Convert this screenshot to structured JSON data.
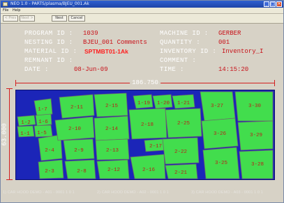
{
  "window": {
    "title": "NEO 1.0 - PARTS/plasma/BJEU_001.Ak",
    "min": "_",
    "max": "□",
    "close": "×"
  },
  "menu": {
    "file": "File",
    "help": "Help"
  },
  "toolbar": {
    "btn1": "< Prev",
    "btn2": "Next >",
    "btn3": "Nest",
    "btn4": "Cancel"
  },
  "info": {
    "program_id_label": "PROGRAM ID :",
    "program_id": "1039",
    "nesting_id_label": "NESTING ID :",
    "nesting_id": "BJEU_001 Comments",
    "material_id_label": "MATERIAL ID :",
    "material_id": "SPTMBT01-1Ak",
    "remnant_id_label": "REMNANT ID :",
    "remnant_id": "",
    "date_label": "DATE :",
    "date": "08-Jun-09",
    "machine_id_label": "MACHINE ID :",
    "machine_id": "GERBER",
    "quantity_label": "QUANTITY :",
    "quantity": "001",
    "inventory_id_label": "INVENTORY ID :",
    "inventory_id": "Inventory_I",
    "comment_label": "COMMENT :",
    "comment": "",
    "time_label": "TIME :",
    "time": "14:15:20"
  },
  "dims": {
    "width": "186.750",
    "height": "63.000"
  },
  "colors": {
    "sheet": "#1b25b8",
    "part": "#42dd4d",
    "part_stroke": "#6a6a6a",
    "label": "#b8221a",
    "dim": "#d21f1f"
  },
  "parts": [
    {
      "label": "1-7"
    },
    {
      "label": "1-2"
    },
    {
      "label": "1-6"
    },
    {
      "label": "1-1"
    },
    {
      "label": "1-5"
    },
    {
      "label": "2-4"
    },
    {
      "label": "2-3"
    },
    {
      "label": "2-11"
    },
    {
      "label": "2-10"
    },
    {
      "label": "2-9"
    },
    {
      "label": "2-8"
    },
    {
      "label": "2-15"
    },
    {
      "label": "2-14"
    },
    {
      "label": "2-13"
    },
    {
      "label": "2-12"
    },
    {
      "label": "1-19"
    },
    {
      "label": "1-20"
    },
    {
      "label": "1-21"
    },
    {
      "label": "2-18"
    },
    {
      "label": "2-17"
    },
    {
      "label": "2-16"
    },
    {
      "label": "2-25"
    },
    {
      "label": "2-22"
    },
    {
      "label": "2-21"
    },
    {
      "label": "3-27"
    },
    {
      "label": "3-26"
    },
    {
      "label": "3-25"
    },
    {
      "label": "3-30"
    },
    {
      "label": "3-29"
    },
    {
      "label": "3-28"
    }
  ],
  "footer": {
    "item1": "1) CAR HOOD DEMO - A01 - 0001 1 0 1",
    "item2": "2) CAR HOOD DEMO - A02 - 0001 1 0 1",
    "item3": "3) CAR HOOD DEMO - A03 - 0001 1 0 1"
  }
}
